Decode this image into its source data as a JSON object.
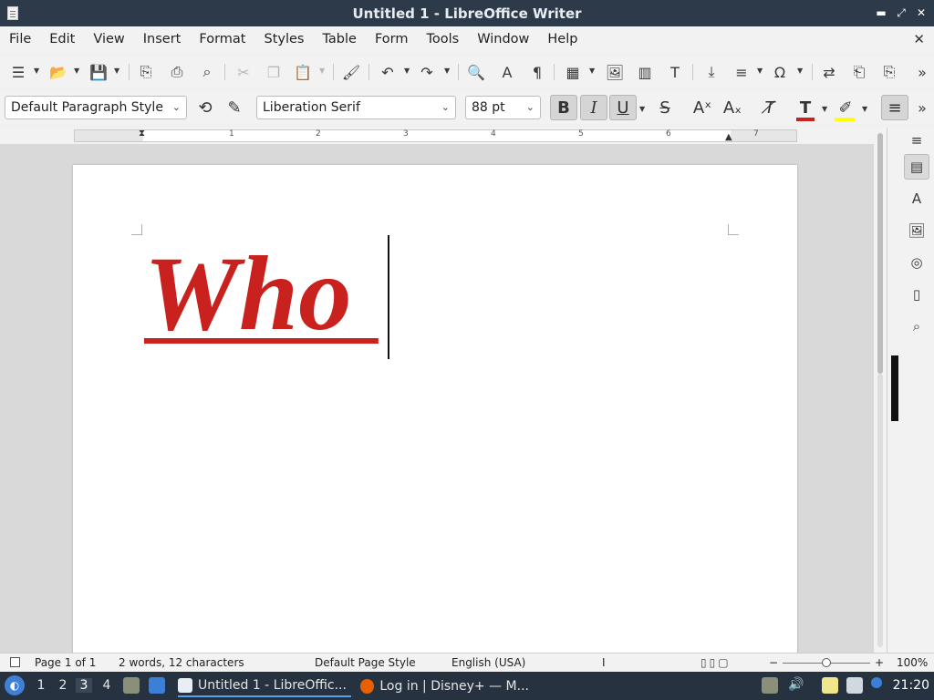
{
  "window": {
    "title": "Untitled 1 - LibreOffice Writer",
    "minimize_icon": "minimize-icon",
    "restore_icon": "restore-icon",
    "close_icon": "close-icon"
  },
  "menu": {
    "items": [
      "File",
      "Edit",
      "View",
      "Insert",
      "Format",
      "Styles",
      "Table",
      "Form",
      "Tools",
      "Window",
      "Help"
    ]
  },
  "formatting": {
    "paragraph_style": "Default Paragraph Style",
    "font_name": "Liberation Serif",
    "font_size": "88 pt",
    "bold": true,
    "italic": true,
    "underline": true,
    "font_color": "#c9211e",
    "highlight_color": "#ffff00"
  },
  "ruler": {
    "labels": [
      "1",
      "2",
      "3",
      "4",
      "5",
      "6",
      "7"
    ]
  },
  "document": {
    "text": "Who ",
    "text_color": "#c9211e"
  },
  "status": {
    "page": "Page 1 of 1",
    "words": "2 words, 12 characters",
    "page_style": "Default Page Style",
    "language": "English (USA)",
    "zoom_minus": "−",
    "zoom_plus": "+",
    "zoom": "100%"
  },
  "taskbar": {
    "workspaces": [
      "1",
      "2",
      "3",
      "4"
    ],
    "active_workspace": "3",
    "apps": [
      {
        "label": "Untitled 1 - LibreOffic...",
        "active": true
      },
      {
        "label": "Log in | Disney+ — M...",
        "active": false
      }
    ],
    "clock": "21:20"
  }
}
